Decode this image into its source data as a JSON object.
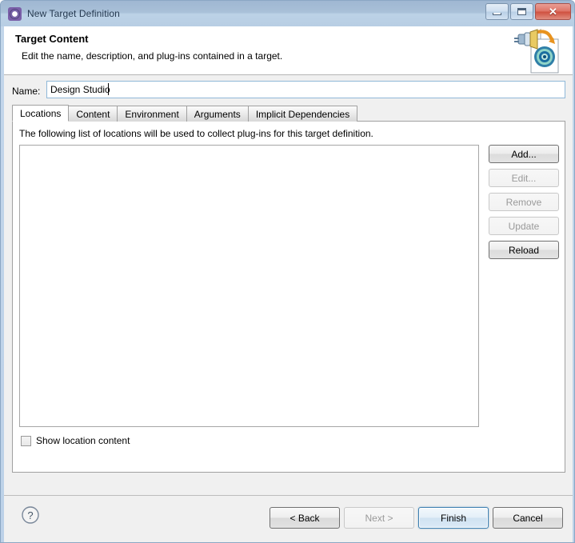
{
  "window": {
    "title": "New Target Definition",
    "title_icon": "target-definition-icon",
    "controls": {
      "minimize": "minimize-icon",
      "maximize": "maximize-icon",
      "close": "✕"
    }
  },
  "banner": {
    "title": "Target Content",
    "description": "Edit the name, description, and plug-ins contained in a target.",
    "icon": "plug-to-target-page-icon"
  },
  "form": {
    "name_label": "Name:",
    "name_value": "Design Studio",
    "name_placeholder": ""
  },
  "tabs": [
    {
      "label": "Locations",
      "active": true
    },
    {
      "label": "Content",
      "active": false
    },
    {
      "label": "Environment",
      "active": false
    },
    {
      "label": "Arguments",
      "active": false
    },
    {
      "label": "Implicit Dependencies",
      "active": false
    }
  ],
  "locations_tab": {
    "description": "The following list of locations will be used to collect plug-ins for this target definition.",
    "list_items": [],
    "buttons": [
      {
        "label": "Add...",
        "enabled": true
      },
      {
        "label": "Edit...",
        "enabled": false
      },
      {
        "label": "Remove",
        "enabled": false
      },
      {
        "label": "Update",
        "enabled": false
      },
      {
        "label": "Reload",
        "enabled": true
      }
    ],
    "show_location_content": {
      "label": "Show location content",
      "checked": false
    }
  },
  "footer": {
    "help_icon": "help-question-icon",
    "buttons": [
      {
        "label": "< Back",
        "enabled": true,
        "default": false
      },
      {
        "label": "Next >",
        "enabled": false,
        "default": false
      },
      {
        "label": "Finish",
        "enabled": true,
        "default": true
      },
      {
        "label": "Cancel",
        "enabled": true,
        "default": false
      }
    ]
  },
  "colors": {
    "titlebar_top": "#9fb7d2",
    "titlebar_bottom": "#b8cee4",
    "dialog_bg": "#f0f0f0",
    "close_red": "#cf503f",
    "focus_blue": "#3c7fb1",
    "field_border": "#8fb8d8"
  }
}
